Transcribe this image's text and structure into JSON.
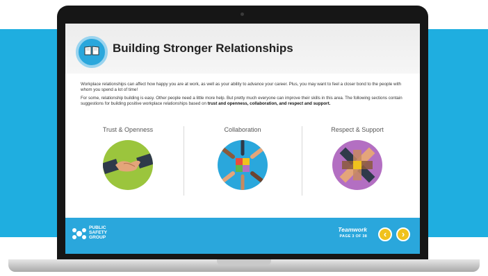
{
  "title": "Building Stronger Relationships",
  "paragraphs": {
    "p1": "Workplace relationships can affect how happy you are at work, as well as your ability to advance your career. Plus, you may want to feel a closer bond to the people with whom you spend a lot of time!",
    "p2_intro": "For some, relationship building is easy. Other people need a little more help. But pretty much everyone can improve their skills in this area. The following sections contain suggestions for building positive workplace relationships based on ",
    "p2_bold": "trust and openness, collaboration, and respect and support."
  },
  "topics": [
    {
      "label": "Trust & Openness",
      "icon": "handshake-icon",
      "color": "#9bc53d"
    },
    {
      "label": "Collaboration",
      "icon": "puzzle-hands-icon",
      "color": "#2aa7dc"
    },
    {
      "label": "Respect & Support",
      "icon": "interlocked-arms-icon",
      "color": "#b36fc2"
    }
  ],
  "footer": {
    "logo_lines": [
      "PUBLIC",
      "SAFETY",
      "GROUP"
    ],
    "course": "Teamwork",
    "page": "PAGE 3 OF 38",
    "prev_symbol": "‹",
    "next_symbol": "›"
  },
  "colors": {
    "accent": "#2aa7dc",
    "nav_button": "#f0c21d",
    "background_band": "#1faee0"
  }
}
